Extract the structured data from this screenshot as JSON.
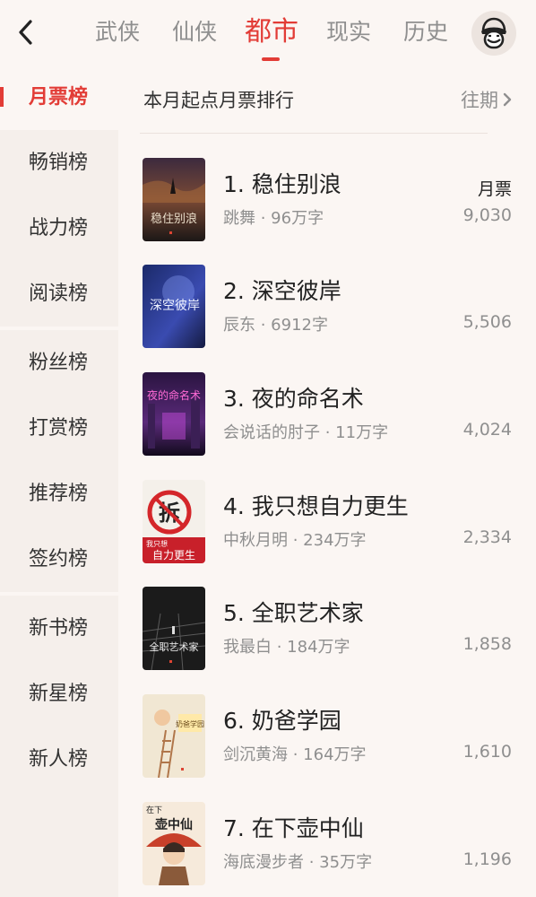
{
  "tabs": [
    {
      "label": "武侠",
      "active": false
    },
    {
      "label": "仙侠",
      "active": false
    },
    {
      "label": "都市",
      "active": true
    },
    {
      "label": "现实",
      "active": false
    },
    {
      "label": "历史",
      "active": false
    }
  ],
  "sidebar": {
    "groups": [
      [
        "月票榜",
        "畅销榜",
        "战力榜",
        "阅读榜"
      ],
      [
        "粉丝榜",
        "打赏榜",
        "推荐榜",
        "签约榜"
      ],
      [
        "新书榜",
        "新星榜",
        "新人榜"
      ]
    ],
    "active": "月票榜"
  },
  "header": {
    "title": "本月起点月票排行",
    "past_label": "往期"
  },
  "column_header": "月票",
  "books": [
    {
      "title": "1. 稳住别浪",
      "meta": "跳舞 · 96万字",
      "votes": "9,030",
      "cover_text": "稳住别浪"
    },
    {
      "title": "2. 深空彼岸",
      "meta": "辰东 · 6912字",
      "votes": "5,506",
      "cover_text": "深空彼岸"
    },
    {
      "title": "3. 夜的命名术",
      "meta": "会说话的肘子 · 11万字",
      "votes": "4,024",
      "cover_text": "夜的命名术"
    },
    {
      "title": "4. 我只想自力更生",
      "meta": "中秋月明 · 234万字",
      "votes": "2,334",
      "cover_text": "我只想自力更生",
      "cover_text_small": "我只想",
      "cover_text_big": "自力更生",
      "cover_badge": "拆"
    },
    {
      "title": "5. 全职艺术家",
      "meta": "我最白 · 184万字",
      "votes": "1,858",
      "cover_text": "全职艺术家"
    },
    {
      "title": "6. 奶爸学园",
      "meta": "剑沉黄海 · 164万字",
      "votes": "1,610",
      "cover_text": "奶爸学园"
    },
    {
      "title": "7. 在下壶中仙",
      "meta": "海底漫步者 · 35万字",
      "votes": "1,196",
      "cover_text": "壶中仙",
      "cover_text_small": "在下"
    }
  ],
  "colors": {
    "accent": "#e23c36",
    "muted": "#8f8f8f",
    "background": "#fbf6f3",
    "sidebar": "#f5efeb"
  }
}
